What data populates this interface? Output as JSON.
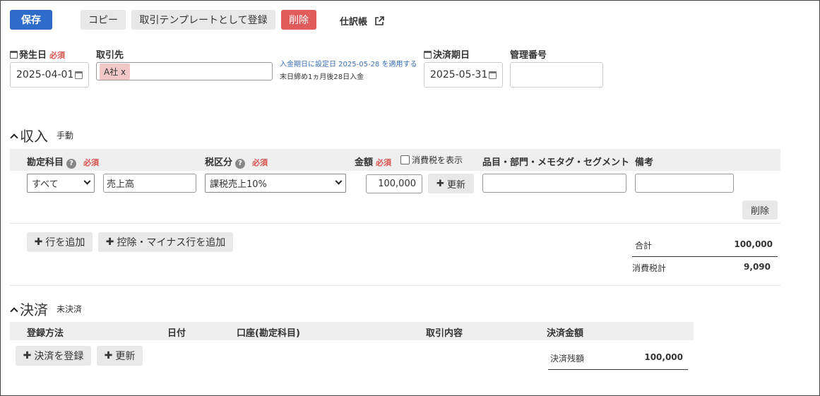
{
  "toolbar": {
    "save": "保存",
    "copy": "コピー",
    "register_template": "取引テンプレートとして登録",
    "delete": "削除",
    "journal": "仕訳帳"
  },
  "header": {
    "issue_date_label": "発生日",
    "issue_date_value": "2025-04-01",
    "required": "必須",
    "partner_label": "取引先",
    "partner_tag": "A社 x",
    "deposit_hint": "入金期日に設定日 2025-05-28 を適用する",
    "closing_rule": "末日締め1ヵ月後28日入金",
    "due_date_label": "決済期日",
    "due_date_value": "2025-05-31",
    "mgmt_no_label": "管理番号",
    "mgmt_no_value": ""
  },
  "income": {
    "title": "収入",
    "mode": "手動",
    "col_account": "勘定科目",
    "col_tax": "税区分",
    "col_amount": "金額",
    "show_tax_label": "消費税を表示",
    "col_items": "品目・部門・メモタグ・セグメント",
    "col_note": "備考",
    "row": {
      "account_filter": "すべて",
      "account": "売上高",
      "tax": "課税売上10%",
      "amount": "100,000",
      "update": "更新",
      "items": "",
      "note": "",
      "delete": "削除"
    },
    "add_row": "行を追加",
    "add_deduction_row": "控除・マイナス行を追加",
    "total_label": "合計",
    "total_value": "100,000",
    "tax_label": "消費税計",
    "tax_value": "9,090"
  },
  "settlement": {
    "title": "決済",
    "status": "未決済",
    "col_method": "登録方法",
    "col_date": "日付",
    "col_account": "口座(勘定科目)",
    "col_content": "取引内容",
    "col_amount": "決済金額",
    "register": "決済を登録",
    "update": "更新",
    "balance_label": "決済残額",
    "balance_value": "100,000"
  }
}
